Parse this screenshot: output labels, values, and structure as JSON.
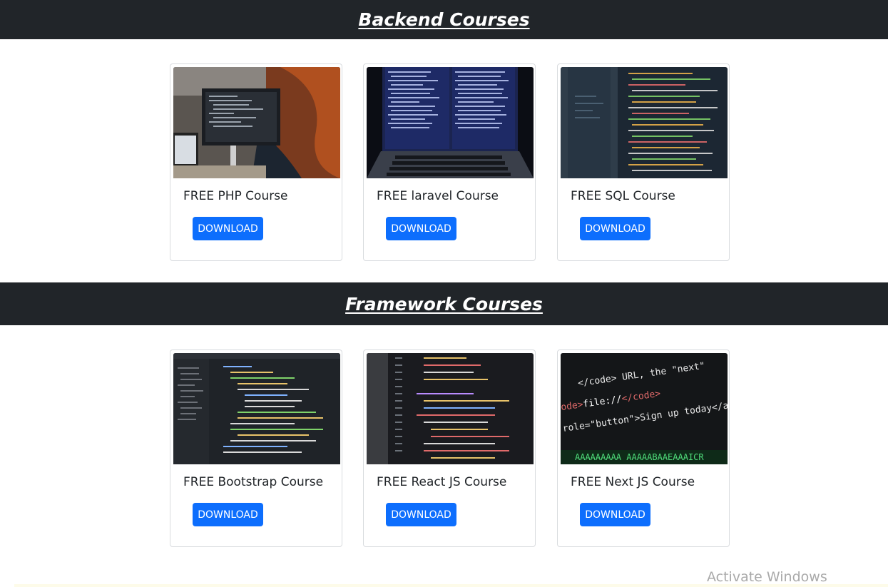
{
  "sections": [
    {
      "title": "Backend Courses",
      "courses": [
        {
          "title": "FREE PHP Course",
          "button": "DOWNLOAD",
          "image": "person-at-monitor-coding-photo"
        },
        {
          "title": "FREE laravel Course",
          "button": "DOWNLOAD",
          "image": "laptop-code-screen-photo"
        },
        {
          "title": "FREE SQL Course",
          "button": "DOWNLOAD",
          "image": "colorful-code-monitor-photo"
        }
      ]
    },
    {
      "title": "Framework Courses",
      "courses": [
        {
          "title": "FREE Bootstrap Course",
          "button": "DOWNLOAD",
          "image": "code-editor-dark-photo"
        },
        {
          "title": "FREE React JS Course",
          "button": "DOWNLOAD",
          "image": "code-screen-angled-photo"
        },
        {
          "title": "FREE Next JS Course",
          "button": "DOWNLOAD",
          "image": "html-code-closeup-photo"
        }
      ]
    }
  ],
  "overlay": {
    "watermark": "Activate Windows"
  },
  "colors": {
    "header_bg": "#212529",
    "button_bg": "#0d6efd",
    "card_border": "#d9dcdf"
  }
}
